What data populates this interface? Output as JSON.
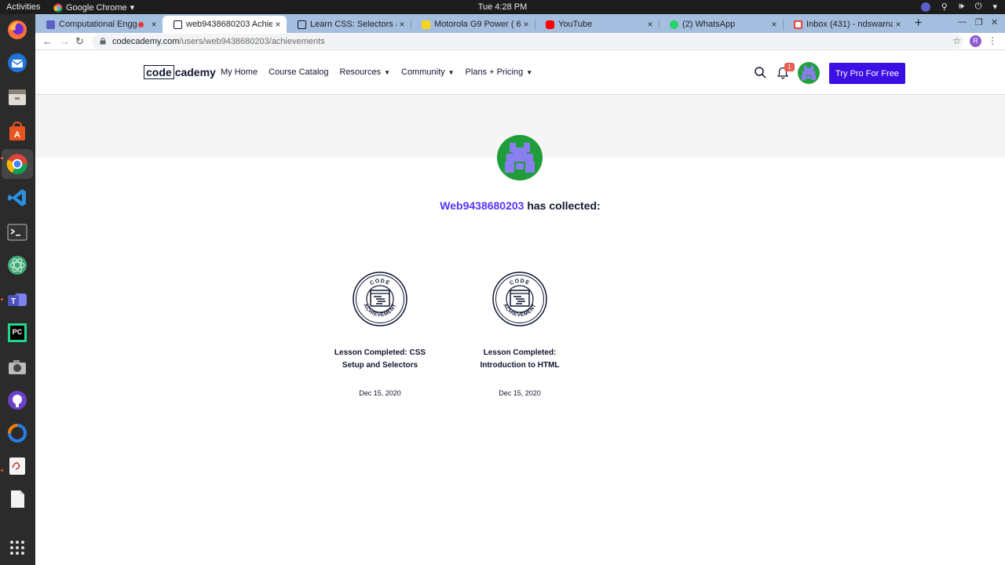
{
  "os": {
    "activities": "Activities",
    "app_name": "Google Chrome",
    "clock": "Tue  4:28 PM"
  },
  "browser": {
    "tabs": [
      {
        "title": "Computational Engg A",
        "active": false
      },
      {
        "title": "web9438680203 Achieven",
        "active": true
      },
      {
        "title": "Learn CSS: Selectors and",
        "active": false
      },
      {
        "title": "Motorola G9 Power ( 64 G",
        "active": false
      },
      {
        "title": "YouTube",
        "active": false
      },
      {
        "title": "(2) WhatsApp",
        "active": false
      },
      {
        "title": "Inbox (431) - ndswarnalat",
        "active": false
      }
    ],
    "url_host": "codecademy.com",
    "url_path": "/users/web9438680203/achievements",
    "profile_initial": "R"
  },
  "site": {
    "logo_code": "code",
    "logo_cademy": "cademy",
    "nav": {
      "my_home": "My Home",
      "course_catalog": "Course Catalog",
      "resources": "Resources",
      "community": "Community",
      "plans": "Plans + Pricing"
    },
    "notification_count": "1",
    "cta": "Try Pro For Free"
  },
  "profile": {
    "username": "Web9438680203",
    "collected_suffix": " has collected:"
  },
  "achievements": [
    {
      "title_line1": "Lesson Completed: CSS",
      "title_line2": "Setup and Selectors",
      "date": "Dec 15, 2020"
    },
    {
      "title_line1": "Lesson Completed:",
      "title_line2": "Introduction to HTML",
      "date": "Dec 15, 2020"
    }
  ],
  "badge_text": {
    "top": "CODE",
    "bottom": "ACHIEVEMENT"
  },
  "colors": {
    "brand_blue": "#3a10e5",
    "username": "#5533ff",
    "avatar_green": "#1f9d3a",
    "avatar_purple": "#8a7ff0"
  }
}
